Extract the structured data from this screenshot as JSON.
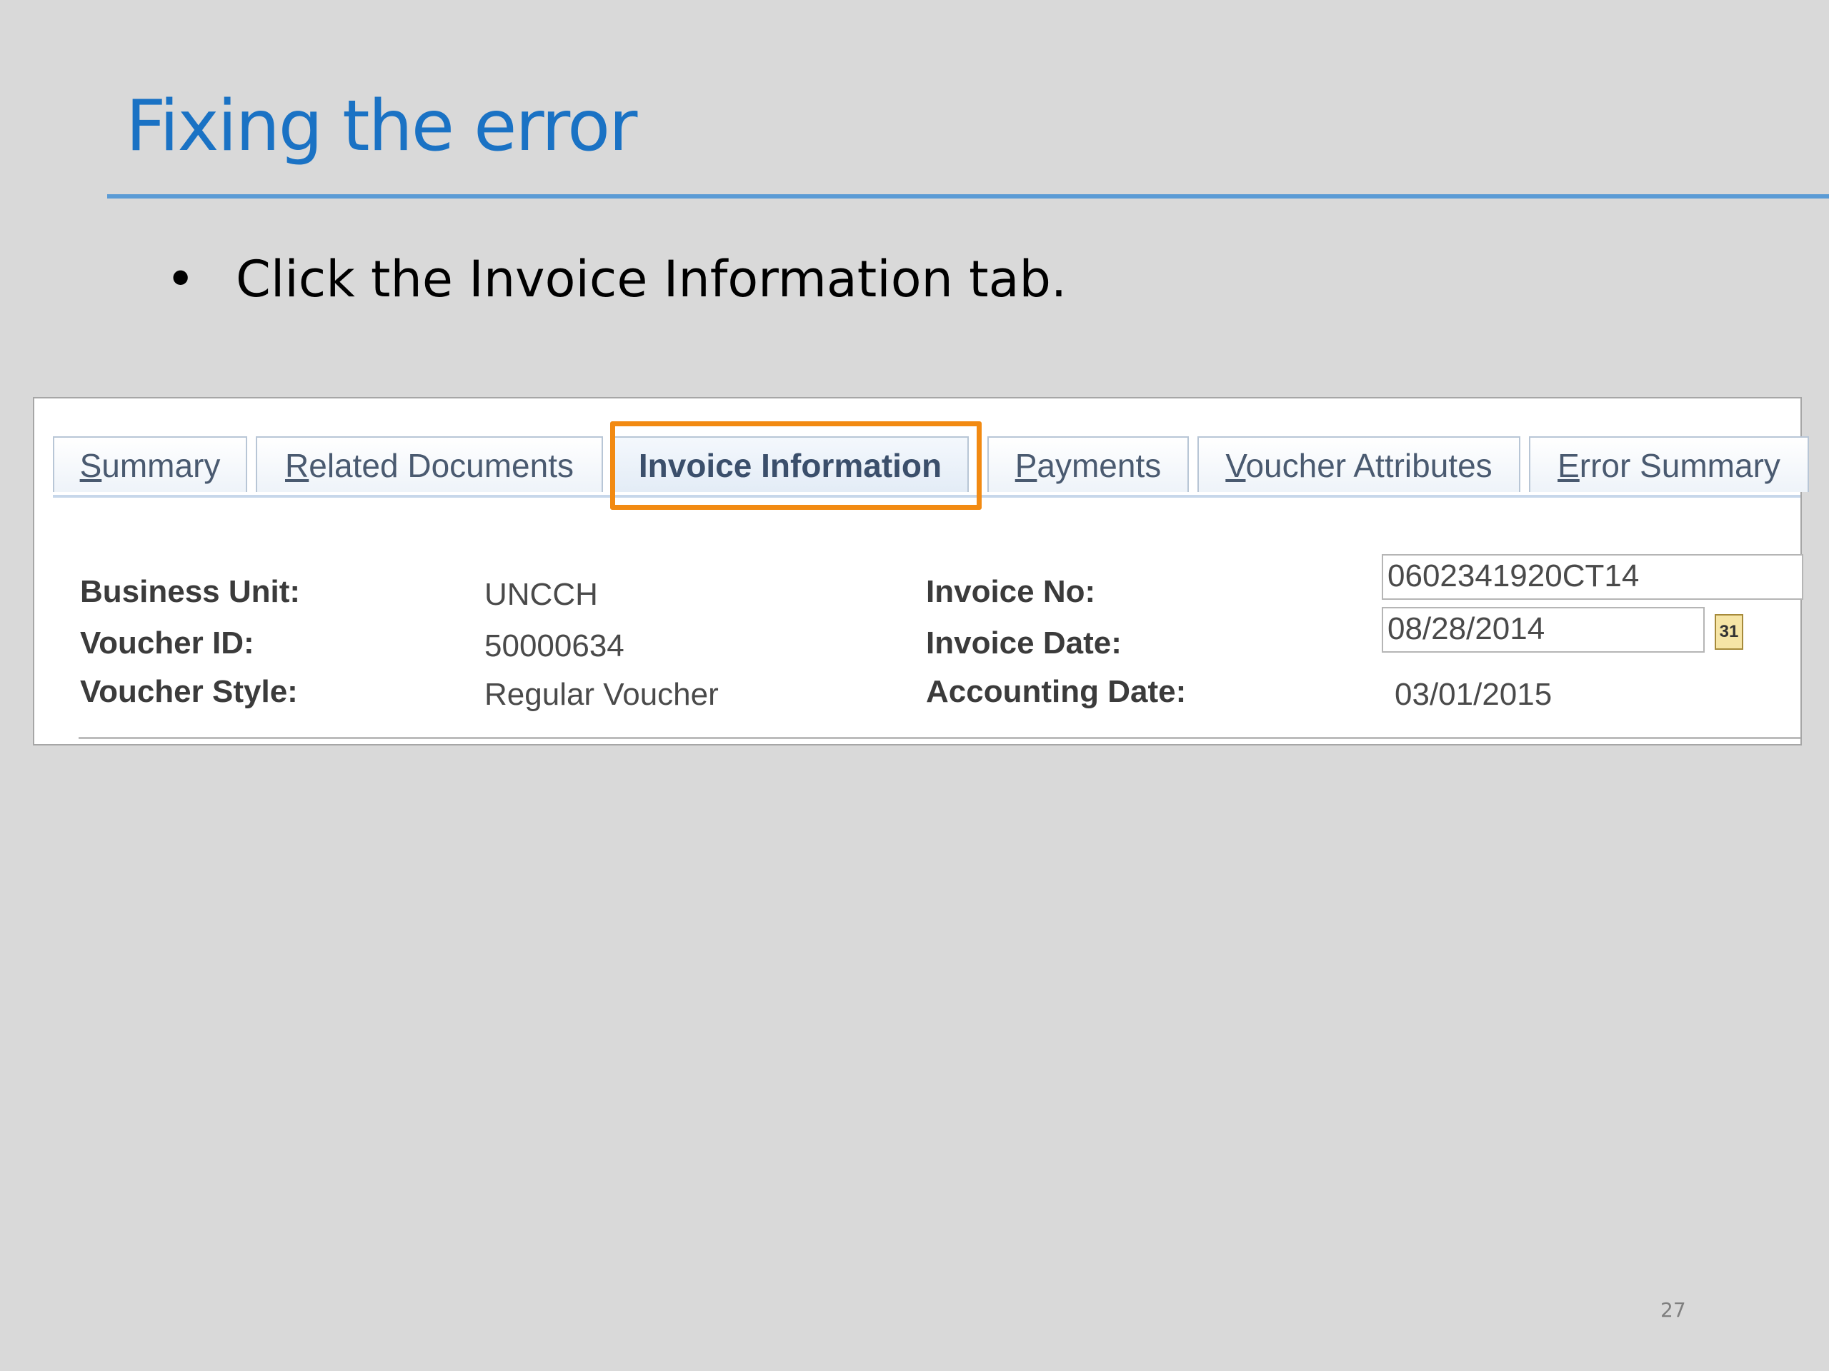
{
  "slide": {
    "title": "Fixing the error",
    "bullet_symbol": "•",
    "bullet_text": "Click the Invoice Information tab.",
    "page_number": "27"
  },
  "tabs": [
    {
      "first": "S",
      "rest": "ummary",
      "active": false
    },
    {
      "first": "R",
      "rest": "elated Documents",
      "active": false
    },
    {
      "first": "",
      "rest": "Invoice Information",
      "active": true
    },
    {
      "first": "P",
      "rest": "ayments",
      "active": false
    },
    {
      "first": "V",
      "rest": "oucher Attributes",
      "active": false
    },
    {
      "first": "E",
      "rest": "rror Summary",
      "active": false
    }
  ],
  "fields": {
    "business_unit_label": "Business Unit:",
    "business_unit_value": "UNCCH",
    "voucher_id_label": "Voucher ID:",
    "voucher_id_value": "50000634",
    "voucher_style_label": "Voucher Style:",
    "voucher_style_value": "Regular Voucher",
    "invoice_no_label": "Invoice No:",
    "invoice_no_value": "0602341920CT14",
    "invoice_date_label": "Invoice Date:",
    "invoice_date_value": "08/28/2014",
    "accounting_date_label": "Accounting Date:",
    "accounting_date_value": "03/01/2015",
    "calendar_icon_text": "31"
  },
  "colors": {
    "title": "#1a72c4",
    "highlight": "#f28a12",
    "background": "#d9d9d9"
  }
}
